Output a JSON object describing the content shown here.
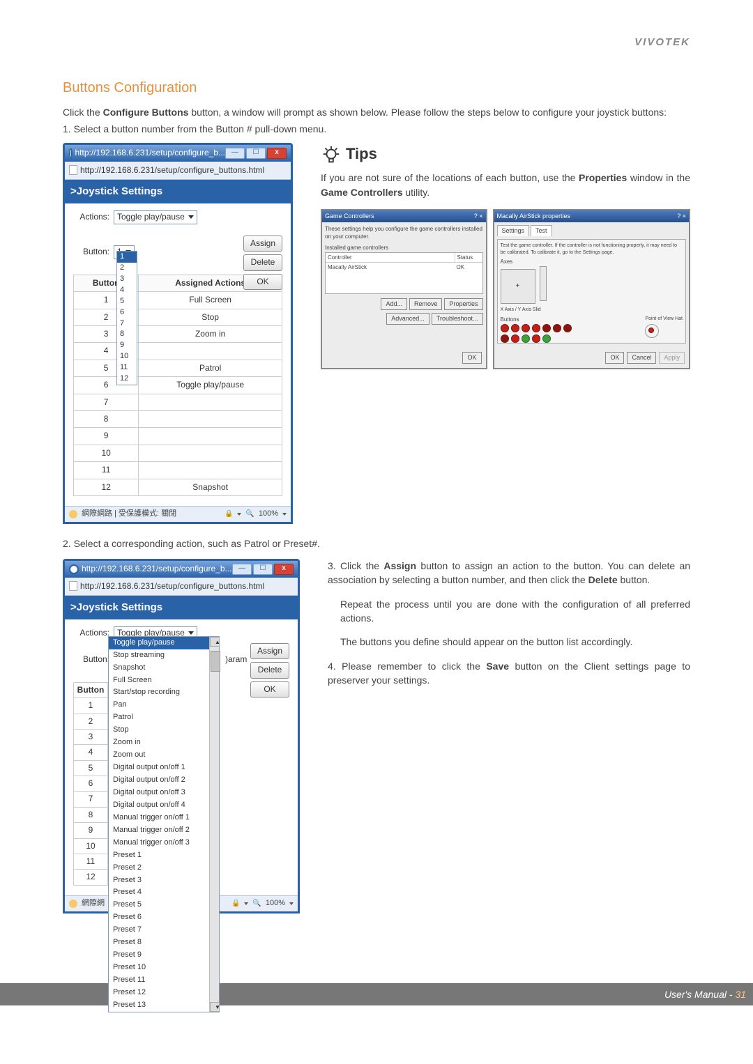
{
  "brand": "VIVOTEK",
  "section_title": "Buttons Configuration",
  "intro_html_prefix": "Click the ",
  "intro_bold1": "Configure Buttons",
  "intro_html_mid": " button, a window will prompt as shown below. Please follow the steps below to configure your joystick buttons:",
  "step1": "1. Select a button number from the Button # pull-down menu.",
  "window1": {
    "title": "http://192.168.6.231/setup/configure_b...",
    "addr": "http://192.168.6.231/setup/configure_buttons.html",
    "header": ">Joystick Settings",
    "actions_label": "Actions:",
    "actions_value": "Toggle play/pause",
    "button_label": "Button:",
    "button_value": "1",
    "assign_btn": "Assign",
    "delete_btn": "Delete",
    "ok_btn": "OK",
    "drop_values": [
      "1",
      "2",
      "3",
      "4",
      "5",
      "6",
      "7",
      "8",
      "9",
      "10",
      "11",
      "12"
    ],
    "table_headers": [
      "Button",
      "Assigned Actions"
    ],
    "table_rows": [
      [
        "1",
        "Full Screen"
      ],
      [
        "2",
        "Stop"
      ],
      [
        "3",
        "Zoom in"
      ],
      [
        "4",
        ""
      ],
      [
        "5",
        "Patrol"
      ],
      [
        "6",
        "Toggle play/pause"
      ],
      [
        "7",
        ""
      ],
      [
        "8",
        ""
      ],
      [
        "9",
        ""
      ],
      [
        "10",
        ""
      ],
      [
        "11",
        ""
      ],
      [
        "12",
        "Snapshot"
      ]
    ],
    "status_left": "網際網路 | 受保護模式: 關閉",
    "zoom": "100%"
  },
  "tips_title": "Tips",
  "tips_text_prefix": "If you are not sure of the locations of each button, use the ",
  "tips_bold1": "Properties",
  "tips_text_mid": " window in the ",
  "tips_bold2": "Game Controllers",
  "tips_text_suffix": " utility.",
  "gc_left": {
    "title": "Game Controllers",
    "desc": "These settings help you configure the game controllers installed on your computer.",
    "installed_label": "Installed game controllers",
    "col1": "Controller",
    "col2": "Status",
    "row_controller": "Macally AirStick",
    "row_status": "OK",
    "add_btn": "Add...",
    "remove_btn": "Remove",
    "properties_btn": "Properties",
    "advanced_btn": "Advanced...",
    "troubleshoot_btn": "Troubleshoot...",
    "ok_btn": "OK"
  },
  "gc_right": {
    "title": "Macally AirStick properties",
    "tab1": "Settings",
    "tab2": "Test",
    "desc": "Test the game controller. If the controller is not functioning properly, it may need to be calibrated. To calibrate it, go to the Settings page.",
    "axes_label": "Axes",
    "axis_caption": "X Axis / Y Axis      Slid",
    "buttons_label": "Buttons",
    "pov_label": "Point of View Hat",
    "ok_btn": "OK",
    "cancel_btn": "Cancel",
    "apply_btn": "Apply"
  },
  "step2": "2. Select a corresponding action, such as Patrol or Preset#.",
  "window2": {
    "title": "http://192.168.6.231/setup/configure_b...",
    "addr": "http://192.168.6.231/setup/configure_buttons.html",
    "header": ">Joystick Settings",
    "actions_label": "Actions:",
    "actions_value": "Toggle play/pause",
    "param_label": ")aram",
    "button_label": "Button:",
    "assign_btn": "Assign",
    "delete_btn": "Delete",
    "ok_btn": "OK",
    "action_options": [
      "Toggle play/pause",
      "Stop streaming",
      "Snapshot",
      "Full Screen",
      "Start/stop recording",
      "Pan",
      "Patrol",
      "Stop",
      "Zoom in",
      "Zoom out",
      "Digital output on/off 1",
      "Digital output on/off 2",
      "Digital output on/off 3",
      "Digital output on/off 4",
      "Manual trigger on/off 1",
      "Manual trigger on/off 2",
      "Manual trigger on/off 3",
      "Preset 1",
      "Preset 2",
      "Preset 3",
      "Preset 4",
      "Preset 5",
      "Preset 6",
      "Preset 7",
      "Preset 8",
      "Preset 9",
      "Preset 10",
      "Preset 11",
      "Preset 12",
      "Preset 13"
    ],
    "button_col": "Button",
    "button_numbers": [
      "1",
      "2",
      "3",
      "4",
      "5",
      "6",
      "7",
      "8",
      "9",
      "10",
      "11",
      "12"
    ],
    "status_left": "網際網",
    "zoom": "100%"
  },
  "right2": {
    "p1_pre": "3. Click the ",
    "p1_b1": "Assign",
    "p1_mid": " button to assign an action to the button. You can delete an association by selecting a button number, and then click the ",
    "p1_b2": "Delete",
    "p1_suf": " button.",
    "p2": "Repeat the process until you are done with the configuration of all preferred actions.",
    "p3": "The buttons you define should appear on the button list accordingly.",
    "p4_pre": "4. Please remember to click the ",
    "p4_b1": "Save",
    "p4_suf": " button on the Client settings page to preserver your settings."
  },
  "footer_label": "User's Manual - ",
  "page_number": "31"
}
